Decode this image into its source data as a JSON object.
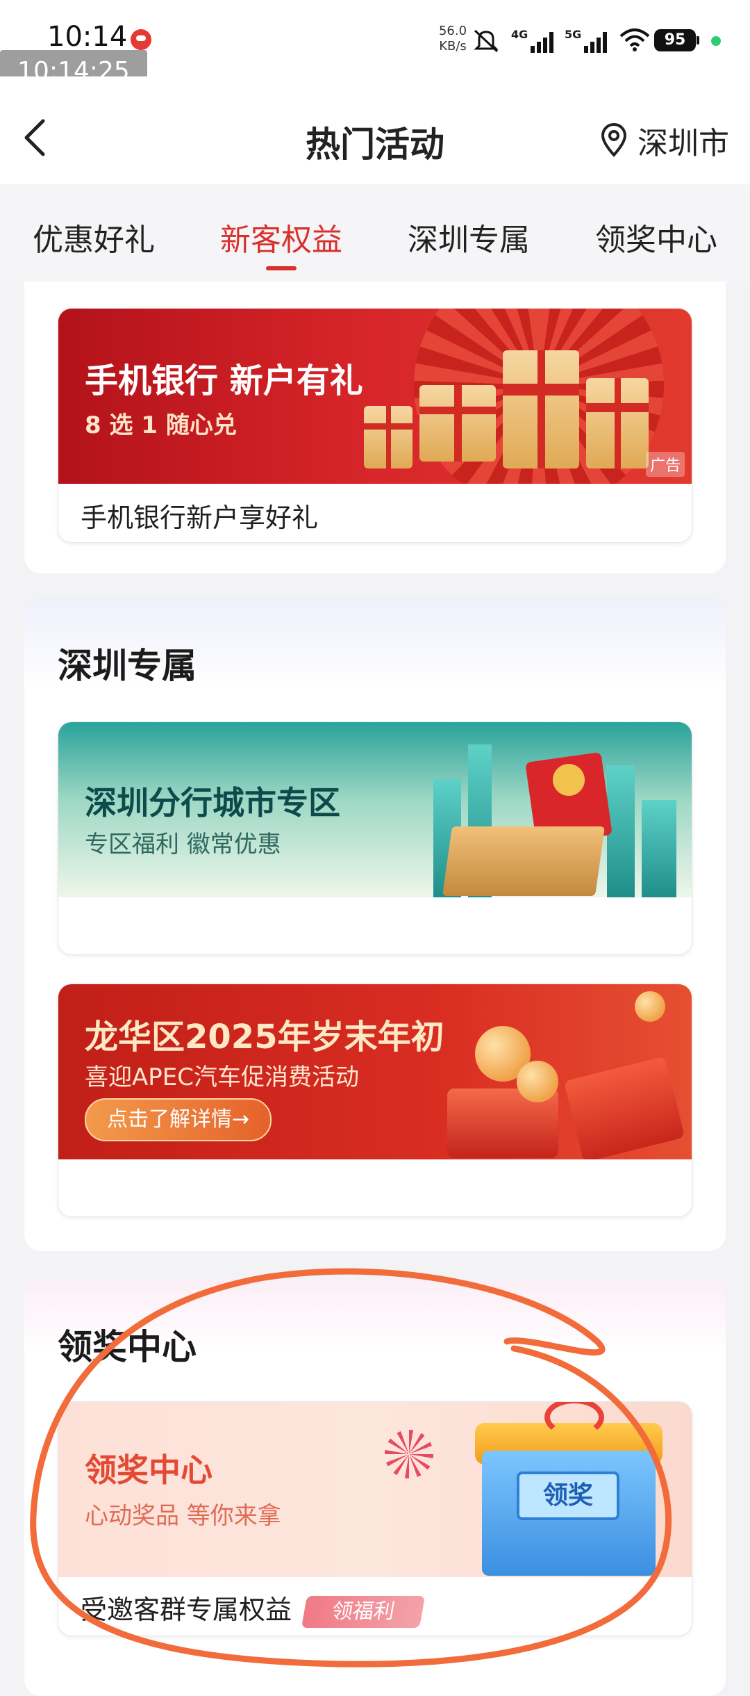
{
  "status_bar": {
    "time": "10:14",
    "timestamp_overlay": "10:14:25",
    "net_speed_value": "56.0",
    "net_speed_unit": "KB/s",
    "signal_1": "4G",
    "signal_2": "5G",
    "battery": "95",
    "icons": [
      "app-notification-icon",
      "mute-icon",
      "signal-icon",
      "wifi-icon",
      "battery-icon"
    ]
  },
  "header": {
    "title": "热门活动",
    "location": "深圳市",
    "icons": [
      "back-chevron-icon",
      "location-pin-icon"
    ]
  },
  "tabs": [
    {
      "label": "优惠好礼",
      "active": false
    },
    {
      "label": "新客权益",
      "active": true
    },
    {
      "label": "深圳专属",
      "active": false
    },
    {
      "label": "领奖中心",
      "active": false
    }
  ],
  "sections": {
    "new_customer": {
      "cards": [
        {
          "banner_title": "手机银行 新户有礼",
          "banner_subtitle": "8 选 1 随心兑",
          "ad_badge": "广告",
          "label": "手机银行新户享好礼"
        }
      ]
    },
    "shenzhen": {
      "title": "深圳专属",
      "cards": [
        {
          "banner_title": "深圳分行城市专区",
          "banner_subtitle": "专区福利 徽常优惠",
          "label": ""
        },
        {
          "banner_title": "龙华区2025年岁末年初",
          "banner_subtitle": "喜迎APEC汽车促消费活动",
          "banner_button": "点击了解详情→",
          "label": ""
        }
      ]
    },
    "rewards": {
      "title": "领奖中心",
      "cards": [
        {
          "banner_title": "领奖中心",
          "banner_subtitle": "心动奖品 等你来拿",
          "shop_sign": "领奖",
          "label": "受邀客群专属权益",
          "tag": "领福利"
        }
      ]
    }
  },
  "colors": {
    "accent_red": "#d9302b",
    "annotation_orange": "#f26b3a",
    "page_bg": "#f3f3f5"
  }
}
